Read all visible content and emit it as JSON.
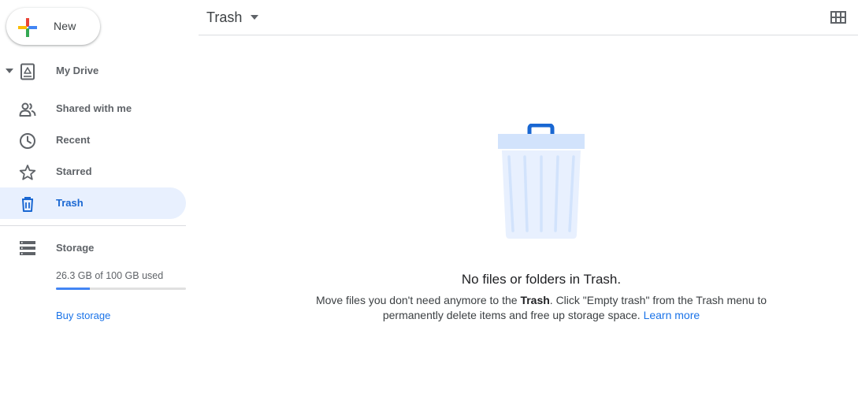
{
  "sidebar": {
    "new_label": "New",
    "items": [
      {
        "label": "My Drive",
        "icon": "my-drive-icon"
      },
      {
        "label": "Shared with me",
        "icon": "shared-icon"
      },
      {
        "label": "Recent",
        "icon": "clock-icon"
      },
      {
        "label": "Starred",
        "icon": "star-icon"
      },
      {
        "label": "Trash",
        "icon": "trash-icon",
        "active": true
      }
    ],
    "storage": {
      "label": "Storage",
      "used_text": "26.3 GB of 100 GB used",
      "used_fraction": 0.263,
      "buy_label": "Buy storage"
    }
  },
  "header": {
    "title": "Trash"
  },
  "empty_state": {
    "title": "No files or folders in Trash.",
    "body_part1": "Move files you don't need anymore to the ",
    "body_bold": "Trash",
    "body_part2": ". Click \"Empty trash\" from the Trash menu to permanently delete items and free up storage space. ",
    "learn_more": "Learn more"
  },
  "colors": {
    "accent": "#1a73e8",
    "active_bg": "#e8f0fe",
    "illustration": "#d2e3fc",
    "illustration_handle": "#1967d2"
  }
}
